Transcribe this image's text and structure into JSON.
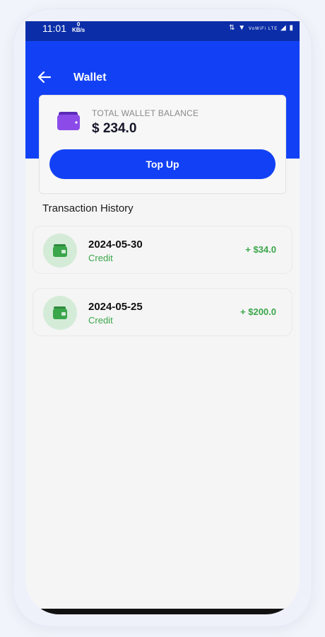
{
  "status_bar": {
    "time": "11:01",
    "net_speed_value": "0",
    "net_speed_unit": "KB/s",
    "indicators": "VoWiFi LTE"
  },
  "header": {
    "title": "Wallet",
    "back_icon": "arrow-left-icon"
  },
  "balance_card": {
    "label": "TOTAL WALLET BALANCE",
    "amount": "$ 234.0",
    "wallet_icon": "wallet-icon",
    "top_up_label": "Top Up"
  },
  "transactions": {
    "title": "Transaction History",
    "items": [
      {
        "date": "2024-05-30",
        "type": "Credit",
        "amount": "+ $34.0"
      },
      {
        "date": "2024-05-25",
        "type": "Credit",
        "amount": "+ $200.0"
      }
    ]
  },
  "colors": {
    "primary_blue": "#1241f5",
    "credit_green": "#3aa64a",
    "wallet_purple": "#8c4be8"
  }
}
